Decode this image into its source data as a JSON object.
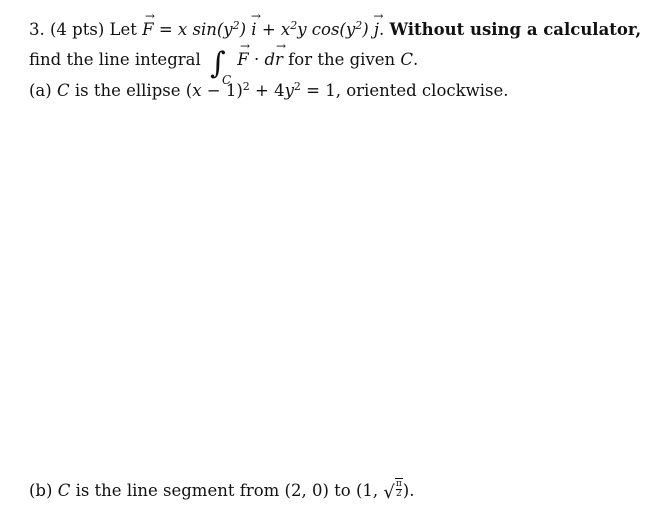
{
  "problem": {
    "number": "3.",
    "points": "(4 pts)",
    "intro_let": "Let",
    "field_symbol": "F",
    "equals": "=",
    "term1_pre": "x sin(y",
    "term1_exp": "2",
    "term1_post": ")",
    "unit_i": "i",
    "plus": "+",
    "term2_x": "x",
    "term2_exp1": "2",
    "term2_mid": "y cos(y",
    "term2_exp2": "2",
    "term2_post": ")",
    "unit_j": "j",
    "period": ".",
    "instruction_bold": "Without using a calculator,",
    "line2_pre": "find the line integral",
    "integral_sign": "∫",
    "integral_sub": "C",
    "dot": "·",
    "d": "d",
    "r_symbol": "r",
    "line2_post": "for the given",
    "line2_c": "C",
    "line2_end": "."
  },
  "part_a": {
    "label": "(a)",
    "c": "C",
    "text1": "is the ellipse (",
    "x": "x",
    "text2": "− 1)",
    "exp1": "2",
    "text3": "+ 4",
    "y": "y",
    "exp2": "2",
    "text4": "= 1, oriented clockwise."
  },
  "part_b": {
    "label": "(b)",
    "c": "C",
    "text1": "is the line segment from (2, 0) to (1,",
    "sqrt_num": "π",
    "sqrt_den": "2",
    "text2": ")."
  },
  "arrow_glyph": "→"
}
